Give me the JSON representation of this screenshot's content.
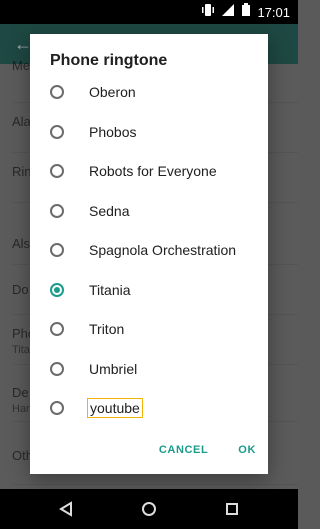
{
  "status_bar": {
    "time": "17:01",
    "icons": [
      "vibrate-icon",
      "signal-icon",
      "battery-icon"
    ]
  },
  "dialog": {
    "title": "Phone ringtone",
    "options": [
      {
        "label": "Oberon",
        "checked": false
      },
      {
        "label": "Phobos",
        "checked": false
      },
      {
        "label": "Robots for Everyone",
        "checked": false
      },
      {
        "label": "Sedna",
        "checked": false
      },
      {
        "label": "Spagnola Orchestration",
        "checked": false
      },
      {
        "label": "Titania",
        "checked": true
      },
      {
        "label": "Triton",
        "checked": false
      },
      {
        "label": "Umbriel",
        "checked": false
      },
      {
        "label": "youtube",
        "checked": false
      }
    ],
    "cancel_label": "CANCEL",
    "ok_label": "OK"
  },
  "background": {
    "rows": [
      {
        "title": "Me",
        "subtitle": ""
      },
      {
        "title": "Ala",
        "subtitle": ""
      },
      {
        "title": "Rin",
        "subtitle": ""
      },
      {
        "title": "Als",
        "subtitle": ""
      },
      {
        "title": "Do",
        "subtitle": ""
      },
      {
        "title": "Pho",
        "subtitle": "Tita"
      },
      {
        "title": "De",
        "subtitle": "Han"
      },
      {
        "title": "Oth",
        "subtitle": ""
      }
    ]
  },
  "nav_bar": {
    "icons": [
      "back-icon",
      "home-icon",
      "recents-icon"
    ]
  },
  "colors": {
    "accent": "#1a9b8b",
    "focus_outline": "#f2b400"
  }
}
